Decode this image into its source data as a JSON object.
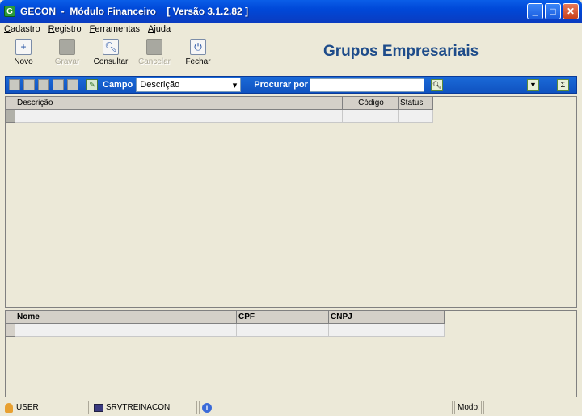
{
  "window": {
    "icon_letter": "G",
    "title": "GECON  -  Módulo Financeiro    [ Versão 3.1.2.82 ]"
  },
  "menu": [
    {
      "label": "Cadastro",
      "accel": "C",
      "rest": "adastro"
    },
    {
      "label": "Registro",
      "accel": "R",
      "rest": "egistro"
    },
    {
      "label": "Ferramentas",
      "accel": "F",
      "rest": "erramentas"
    },
    {
      "label": "Ajuda",
      "accel": "A",
      "rest": "juda"
    }
  ],
  "toolbar": {
    "novo": "Novo",
    "gravar": "Gravar",
    "consultar": "Consultar",
    "cancelar": "Cancelar",
    "fechar": "Fechar"
  },
  "page_title": "Grupos Empresariais",
  "search": {
    "campo_label": "Campo",
    "campo_value": "Descrição",
    "procurar_label": "Procurar por",
    "procurar_value": ""
  },
  "grid_main": {
    "columns": [
      "Descrição",
      "Código",
      "Status"
    ]
  },
  "grid_detail": {
    "columns": [
      "Nome",
      "CPF",
      "CNPJ"
    ]
  },
  "status": {
    "user": "USER",
    "server": "SRVTREINACON",
    "modo_label": "Modo:",
    "modo_value": ""
  }
}
